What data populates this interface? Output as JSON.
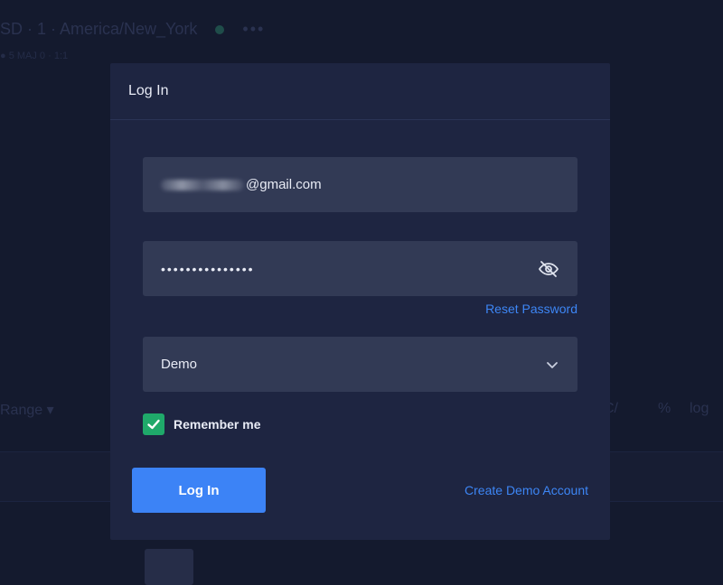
{
  "background": {
    "symbol_text": "SD · 1 · America/New_York",
    "more_text": "•••",
    "subtext": "● 5 MAJ 0 · 1:1",
    "range_text": "Range ▾",
    "right_items": [
      "C/",
      "%",
      "log"
    ]
  },
  "modal": {
    "title": "Log In",
    "email_suffix": "@gmail.com",
    "password_mask": "•••••••••••••••",
    "reset_password_label": "Reset Password",
    "account_type_selected": "Demo",
    "remember_me_label": "Remember me",
    "remember_me_checked": true,
    "login_button_label": "Log In",
    "create_demo_label": "Create Demo Account"
  },
  "colors": {
    "accent": "#3c83f6",
    "checkbox": "#1fa96a",
    "modal_bg": "#1e2541",
    "field_bg": "#323a55"
  },
  "icons": {
    "password_toggle": "eye-off-icon",
    "select_chevron": "chevron-down-icon",
    "checkbox": "check-icon"
  }
}
